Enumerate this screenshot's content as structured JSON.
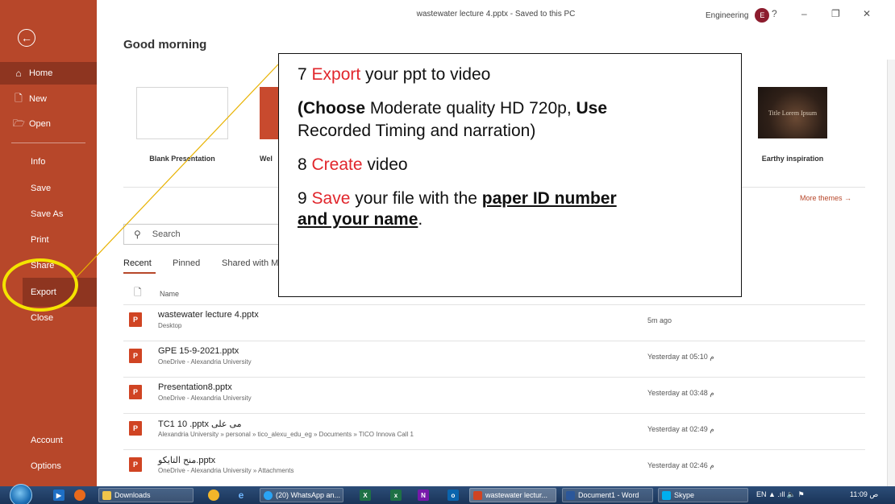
{
  "titlebar": {
    "doc_title": "wastewater lecture 4.pptx  -  Saved to this PC",
    "account_name": "Engineering",
    "avatar_initial": "E",
    "help": "?",
    "minimize": "–",
    "restore": "❐",
    "close": "✕"
  },
  "sidebar": {
    "back_icon": "back-arrow-icon",
    "items": [
      {
        "label": "Home",
        "icon": "home-icon",
        "glyph": "⌂"
      },
      {
        "label": "New",
        "icon": "new-document-icon",
        "glyph": "🗋"
      },
      {
        "label": "Open",
        "icon": "open-folder-icon",
        "glyph": "🗁"
      },
      {
        "label": "Info"
      },
      {
        "label": "Save"
      },
      {
        "label": "Save As"
      },
      {
        "label": "Print"
      },
      {
        "label": "Share"
      },
      {
        "label": "Export"
      },
      {
        "label": "Close"
      },
      {
        "label": "Account"
      },
      {
        "label": "Options"
      }
    ]
  },
  "main": {
    "greeting": "Good morning",
    "templates": [
      {
        "label": "Blank Presentation"
      },
      {
        "label": "Wel"
      },
      {
        "label": "Earthy inspiration",
        "thumb_text": "Title Lorem Ipsum"
      }
    ],
    "more_themes": "More themes  →",
    "search": {
      "placeholder": "Search"
    },
    "tabs": [
      "Recent",
      "Pinned",
      "Shared with M"
    ],
    "list_header": "Name",
    "files": [
      {
        "name": "wastewater lecture 4.pptx",
        "path": "Desktop",
        "time": "5m ago"
      },
      {
        "name": "GPE 15-9-2021.pptx",
        "path": "OneDrive - Alexandria University",
        "time": "Yesterday at 05:10 م"
      },
      {
        "name": "Presentation8.pptx",
        "path": "OneDrive - Alexandria University",
        "time": "Yesterday at 03:48 م"
      },
      {
        "name": "TC1 10 .pptx مى على",
        "path": "Alexandria University » personal » tico_alexu_edu_eg » Documents » TICO Innova Call 1",
        "time": "Yesterday at 02:49 م"
      },
      {
        "name": "منح التايكو.pptx",
        "path": "OneDrive - Alexandria University » Attachments",
        "time": "Yesterday at 02:46 م"
      }
    ]
  },
  "callout": {
    "line1_num": "7 ",
    "line1_red": "Export",
    "line1_rest": " your ppt to video",
    "line2_open": "(",
    "line2_b1": "Choose",
    "line2_mid": " Moderate quality HD 720p, ",
    "line2_b2": "Use",
    "line3": "Recorded Timing and narration)",
    "line4_num": "8 ",
    "line4_red": "Create",
    "line4_rest": " video",
    "line5_num": "9 ",
    "line5_red": "Save",
    "line5_rest": " your file with the ",
    "line5_u": "paper ID number ",
    "line6_u": "and your name",
    "line6_end": "."
  },
  "taskbar": {
    "tasks": [
      "Downloads",
      "(20) WhatsApp an...",
      "wastewater lectur...",
      "Document1 - Word",
      "Skype"
    ],
    "tray": "EN  ▲  .ıll  🔈  ⚑",
    "clock": "11:09 ص"
  },
  "colors": {
    "accent": "#b7472a",
    "callout_red": "#e1262c",
    "highlight_yellow": "#f4e400"
  }
}
